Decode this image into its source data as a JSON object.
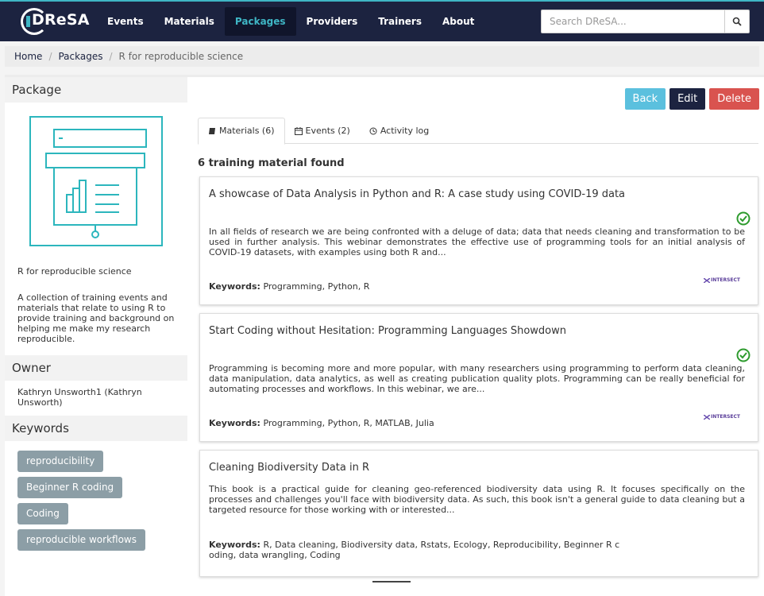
{
  "nav": {
    "brand": "DReSA",
    "links": [
      "Events",
      "Materials",
      "Packages",
      "Providers",
      "Trainers",
      "About"
    ],
    "active": "Packages",
    "search_placeholder": "Search DReSA..."
  },
  "breadcrumb": [
    "Home",
    "Packages",
    "R for reproducible science"
  ],
  "sidebar": {
    "package_heading": "Package",
    "package_title": "R for reproducible science",
    "package_description": "A collection of training events and materials that relate to using R to provide training and background on helping me make my research reproducible.",
    "owner_heading": "Owner",
    "owner": "Kathryn Unsworth1 (Kathryn Unsworth)",
    "keywords_heading": "Keywords",
    "keywords": [
      "reproducibility",
      "Beginner R coding",
      "Coding",
      "reproducible workflows"
    ]
  },
  "actions": {
    "back": "Back",
    "edit": "Edit",
    "delete": "Delete"
  },
  "tabs": [
    {
      "label": "Materials (6)",
      "icon": "book-icon"
    },
    {
      "label": "Events (2)",
      "icon": "calendar-icon"
    },
    {
      "label": "Activity log",
      "icon": "clock-icon"
    }
  ],
  "found_text": "6 training material found",
  "keywords_label": "Keywords:",
  "provider_logo_text": "INTERSECT",
  "materials": [
    {
      "title": "A showcase of Data Analysis in Python and R: A case study using COVID-19 data",
      "description": "In all fields of research we are being confronted with a deluge of data; data that needs cleaning and transformation to be used in further analysis. This webinar demonstrates the effective use of programming tools for an initial analysis of COVID-19 datasets, with examples using both R and...",
      "keywords": "Programming, Python, R",
      "verified": true
    },
    {
      "title": "Start Coding without Hesitation: Programming Languages Showdown",
      "description": "Programming is becoming more and more popular, with many researchers using programming to perform data cleaning, data manipulation, data analytics, as well as creating publication quality plots. Programming can be really beneficial for automating processes and workflows. In this webinar, we are...",
      "keywords": "Programming, Python, R, MATLAB, Julia",
      "verified": true
    },
    {
      "title": "Cleaning Biodiversity Data in R",
      "description": "This book is a practical guide for cleaning geo-referenced biodiversity data using R. It focuses specifically on the processes and challenges you'll face with biodiversity data. As such, this book isn't a general guide to data cleaning but a targeted resource for those working with or interested...",
      "keywords_line1": "R, Data cleaning, Biodiversity data, Rstats, Ecology, Reproducibility, Beginner R c",
      "keywords_line2": "oding, data wrangling, Coding",
      "verified": false
    }
  ],
  "colors": {
    "navbar": "#1c2340",
    "accent": "#3fb6c5",
    "tag": "#8c9ea6",
    "back": "#5bc0de",
    "delete": "#d9534f",
    "verified": "#2e9b2e"
  }
}
